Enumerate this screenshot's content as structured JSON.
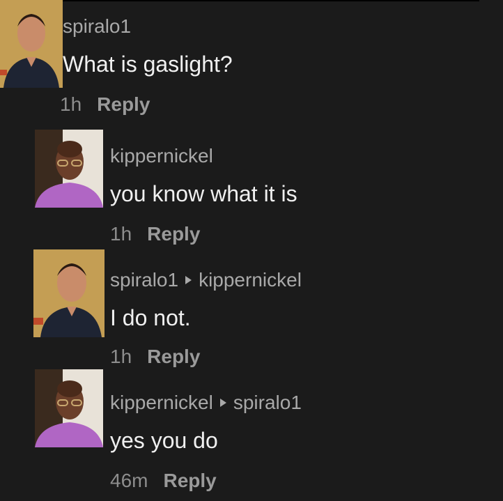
{
  "comments": [
    {
      "username": "spiralo1",
      "reply_to": "",
      "text": "What is gaslight?",
      "time": "1h",
      "reply_label": "Reply"
    },
    {
      "username": "kippernickel",
      "reply_to": "",
      "text": "you know what it is",
      "time": "1h",
      "reply_label": "Reply"
    },
    {
      "username": "spiralo1",
      "reply_to": "kippernickel",
      "text": "I do not.",
      "time": "1h",
      "reply_label": "Reply"
    },
    {
      "username": "kippernickel",
      "reply_to": "spiralo1",
      "text": "yes you do",
      "time": "46m",
      "reply_label": "Reply"
    }
  ],
  "colors": {
    "background": "#1b1b1b",
    "username": "#a9a9a9",
    "text": "#f0f0f0",
    "meta": "#8d8d8d"
  }
}
